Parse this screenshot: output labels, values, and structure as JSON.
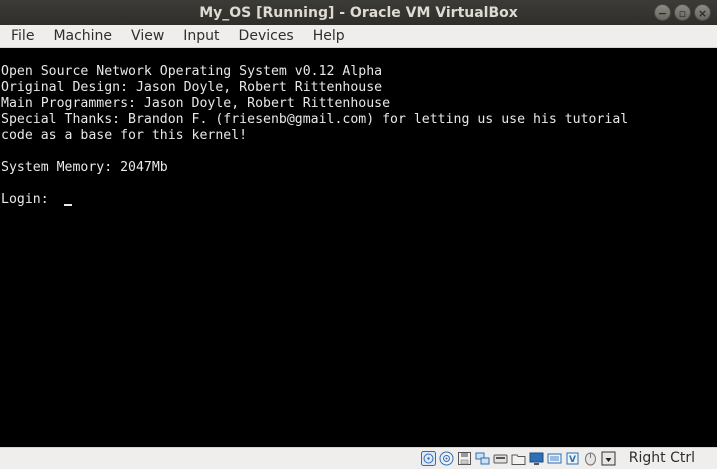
{
  "window": {
    "title": "My_OS [Running] - Oracle VM VirtualBox"
  },
  "menu": {
    "items": [
      "File",
      "Machine",
      "View",
      "Input",
      "Devices",
      "Help"
    ]
  },
  "console": {
    "lines": [
      "Open Source Network Operating System v0.12 Alpha",
      "Original Design: Jason Doyle, Robert Rittenhouse",
      "Main Programmers: Jason Doyle, Robert Rittenhouse",
      "Special Thanks: Brandon F. (friesenb@gmail.com) for letting us use his tutorial",
      "code as a base for this kernel!",
      "",
      "System Memory: 2047Mb",
      "",
      "Login: "
    ]
  },
  "status": {
    "icons": [
      "optical-drive-icon",
      "audio-icon",
      "hard-disk-icon",
      "network-icon",
      "usb-icon",
      "shared-folders-icon",
      "display-icon",
      "video-capture-icon",
      "cpu-icon",
      "mouse-integration-icon",
      "keyboard-icon"
    ],
    "host_key": "Right Ctrl"
  },
  "colors": {
    "titlebar": "#3c3b37",
    "menubar": "#efeeec",
    "screen_bg": "#000000",
    "screen_fg": "#e8e8e8",
    "icon_blue": "#2e6fb5"
  }
}
